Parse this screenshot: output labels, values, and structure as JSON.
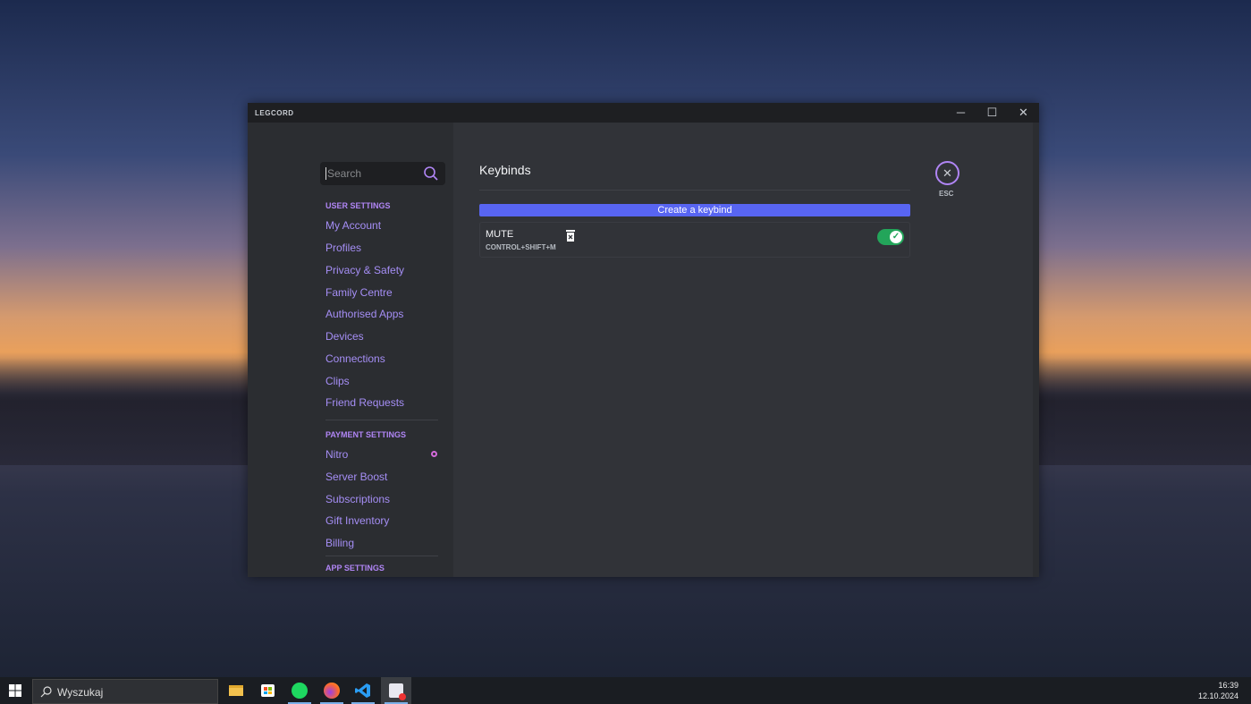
{
  "window": {
    "app_name": "LEGCORD",
    "minimize": "─",
    "maximize": "☐",
    "close": "✕"
  },
  "sidebar": {
    "search_placeholder": "Search",
    "user_settings_header": "USER SETTINGS",
    "user_items": [
      "My Account",
      "Profiles",
      "Privacy & Safety",
      "Family Centre",
      "Authorised Apps",
      "Devices",
      "Connections",
      "Clips",
      "Friend Requests"
    ],
    "payment_settings_header": "PAYMENT SETTINGS",
    "payment_items": [
      "Nitro",
      "Server Boost",
      "Subscriptions",
      "Gift Inventory",
      "Billing"
    ],
    "app_settings_header": "APP SETTINGS"
  },
  "main": {
    "title": "Keybinds",
    "create_button": "Create a keybind",
    "keybinds": [
      {
        "name": "MUTE",
        "keys": "CONTROL+SHIFT+M",
        "enabled": true
      }
    ],
    "esc_label": "ESC"
  },
  "taskbar": {
    "search_placeholder": "Wyszukaj",
    "time": "16:39",
    "date": "12.10.2024"
  },
  "colors": {
    "accent": "#5865f2",
    "link": "#a58ef5",
    "toggle_on": "#23a55a"
  }
}
